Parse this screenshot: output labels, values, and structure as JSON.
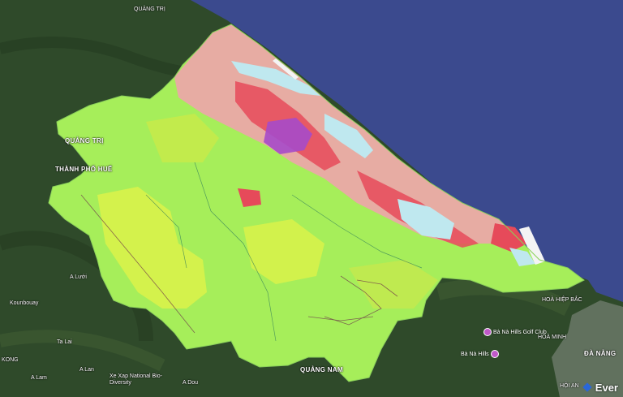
{
  "colors": {
    "sea": "#3b4a8e",
    "land": "#2f4a2a",
    "forest_zone": "#a6ee5a",
    "production_forest": "#d9f24a",
    "residential": "#e64a5a",
    "agriculture": "#f2a0b0",
    "water": "#bfe8ef",
    "urban": "#a64ac9"
  },
  "labels": [
    {
      "text": "QUẢNG TRỊ"
    },
    {
      "text": "THÀNH PHỐ HUẾ"
    },
    {
      "text": "QUẢNG NAM"
    },
    {
      "text": "Xe Xap National Bio-Diversity"
    },
    {
      "text": "A Lưới"
    },
    {
      "text": "Kounbouay"
    },
    {
      "text": "A Lam"
    },
    {
      "text": "A Dou"
    },
    {
      "text": "Ta Lai"
    },
    {
      "text": "A Lan"
    },
    {
      "text": "KONG"
    },
    {
      "text": "HOÀ HIỆP BẮC"
    },
    {
      "text": "HOÀ MINH"
    },
    {
      "text": "ĐÀ NẴNG"
    },
    {
      "text": "HỘI AN"
    },
    {
      "text": "QUẢNG TRỊ"
    }
  ],
  "poi": {
    "label": "Bà Nà Hills Golf Club"
  },
  "poi2": {
    "label": "Bà Nà Hills"
  },
  "brand": {
    "label": "Ever"
  }
}
